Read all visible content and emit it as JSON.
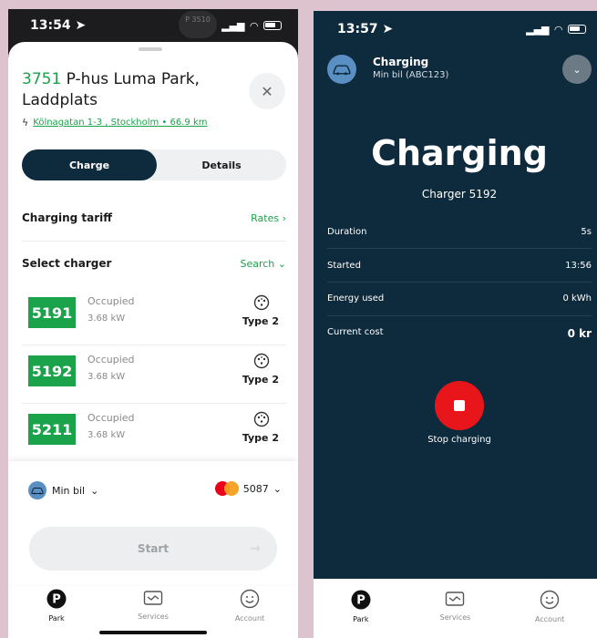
{
  "left": {
    "status": {
      "time": "13:54",
      "island_text": "P 3510"
    },
    "location": {
      "number": "3751",
      "name": "P-hus Luma Park, Laddplats",
      "address": "Kölnagatan 1-3 , Stockholm • 66.9 km"
    },
    "tabs": {
      "charge": "Charge",
      "details": "Details"
    },
    "tariff": {
      "label": "Charging tariff",
      "link": "Rates"
    },
    "select": {
      "label": "Select charger",
      "link": "Search"
    },
    "chargers": [
      {
        "id": "5191",
        "status": "Occupied",
        "power": "3.68 kW",
        "type": "Type 2"
      },
      {
        "id": "5192",
        "status": "Occupied",
        "power": "3.68 kW",
        "type": "Type 2"
      },
      {
        "id": "5211",
        "status": "Occupied",
        "power": "3.68 kW",
        "type": "Type 2"
      }
    ],
    "vehicle": "Min bil",
    "card": "5087",
    "start": "Start"
  },
  "right": {
    "status": {
      "time": "13:57"
    },
    "header": {
      "title": "Charging",
      "subtitle": "Min bil (ABC123)"
    },
    "big_title": "Charging",
    "charger": "Charger 5192",
    "stats": [
      {
        "label": "Duration",
        "value": "5s"
      },
      {
        "label": "Started",
        "value": "13:56"
      },
      {
        "label": "Energy used",
        "value": "0 kWh"
      },
      {
        "label": "Current cost",
        "value": "0 kr"
      }
    ],
    "stop": "Stop charging"
  },
  "tabbar": {
    "park": "Park",
    "services": "Services",
    "account": "Account"
  },
  "colors": {
    "brand_green": "#1aa34a",
    "navy": "#0e2a3d",
    "stop_red": "#e8161b"
  },
  "icons": [
    "location-arrow-icon",
    "signal-icon",
    "wifi-icon",
    "battery-icon",
    "close-icon",
    "bolt-icon",
    "chevron-right-icon",
    "chevron-down-icon",
    "type2-plug-icon",
    "car-icon",
    "mastercard-icon",
    "arrow-right-icon",
    "parking-icon",
    "services-icon",
    "account-icon",
    "stop-icon"
  ]
}
